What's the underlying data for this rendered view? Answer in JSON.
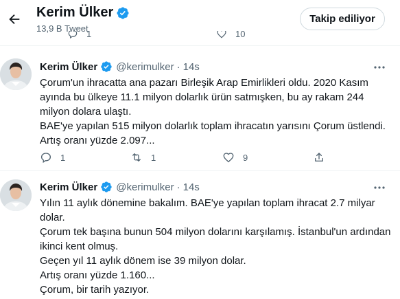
{
  "header": {
    "name": "Kerim Ülker",
    "tweet_count": "13,9 B Tweet",
    "follow_button": "Takip ediliyor",
    "ghost_count_1": "1",
    "ghost_count_2": "10"
  },
  "tweets": [
    {
      "name": "Kerim Ülker",
      "handle": "@kerimulker",
      "separator": "·",
      "time": "14s",
      "lines": [
        "Çorum'un ihracatta ana pazarı Birleşik Arap Emirlikleri oldu. 2020 Kasım",
        "ayında bu ülkeye 11.1 milyon dolarlık ürün satmışken, bu ay rakam 244",
        "milyon dolara ulaştı.",
        "BAE'ye yapılan 515 milyon dolarlık toplam ihracatın yarısını Çorum üstlendi.",
        "Artış oranı yüzde 2.097..."
      ],
      "reply_count": "1",
      "retweet_count": "1",
      "like_count": "9"
    },
    {
      "name": "Kerim Ülker",
      "handle": "@kerimulker",
      "separator": "·",
      "time": "14s",
      "lines": [
        "Yılın 11 aylık dönemine bakalım. BAE'ye yapılan toplam ihracat 2.7 milyar",
        "dolar.",
        "Çorum tek başına bunun 504 milyon dolarını karşılamış. İstanbul'un ardından",
        "ikinci kent olmuş.",
        "Geçen yıl 11 aylık dönem ise 39 milyon dolar.",
        "Artış oranı yüzde 1.160...",
        "Çorum, bir tarih yazıyor."
      ]
    }
  ],
  "colors": {
    "verified": "#1d9bf0",
    "secondary_text": "#536471",
    "border": "#eff3f4"
  },
  "icons": [
    "back-arrow-icon",
    "verified-badge-icon",
    "more-icon",
    "reply-icon",
    "retweet-icon",
    "like-icon",
    "share-icon"
  ]
}
